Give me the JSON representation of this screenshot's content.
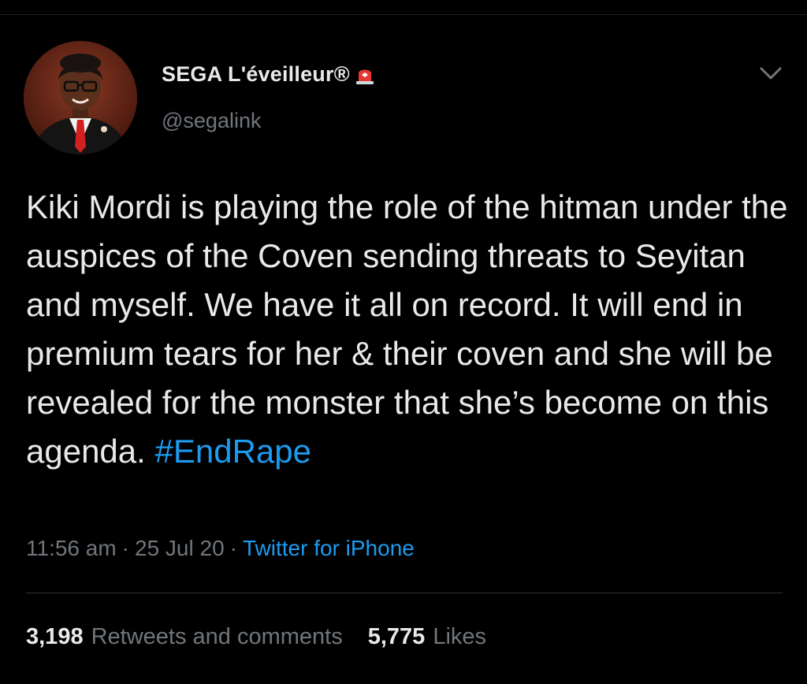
{
  "tweet": {
    "author": {
      "display_name": "SEGA L'éveilleur®",
      "handle": "@segalink",
      "avatar_icon": "profile-photo",
      "badge_icon": "siren-emoji"
    },
    "menu_icon": "chevron-down-icon",
    "text_parts": [
      "Kiki Mordi is playing the role of the hitman under the auspices of the Coven sending threats to Seyitan and myself. We have it all on record. It will end in premium tears for her & their coven and she will be revealed for the monster that she’s become on this agenda. ",
      "#EndRape"
    ],
    "time": "11:56 am",
    "separator": "·",
    "date": "25 Jul 20",
    "source": "Twitter for iPhone",
    "stats": {
      "retweets_count": "3,198",
      "retweets_label": "Retweets and comments",
      "likes_count": "5,775",
      "likes_label": "Likes"
    }
  },
  "colors": {
    "background": "#000000",
    "text": "#e7e9ea",
    "secondary": "#71767b",
    "accent": "#1d9bf0",
    "divider": "#2f3336"
  }
}
